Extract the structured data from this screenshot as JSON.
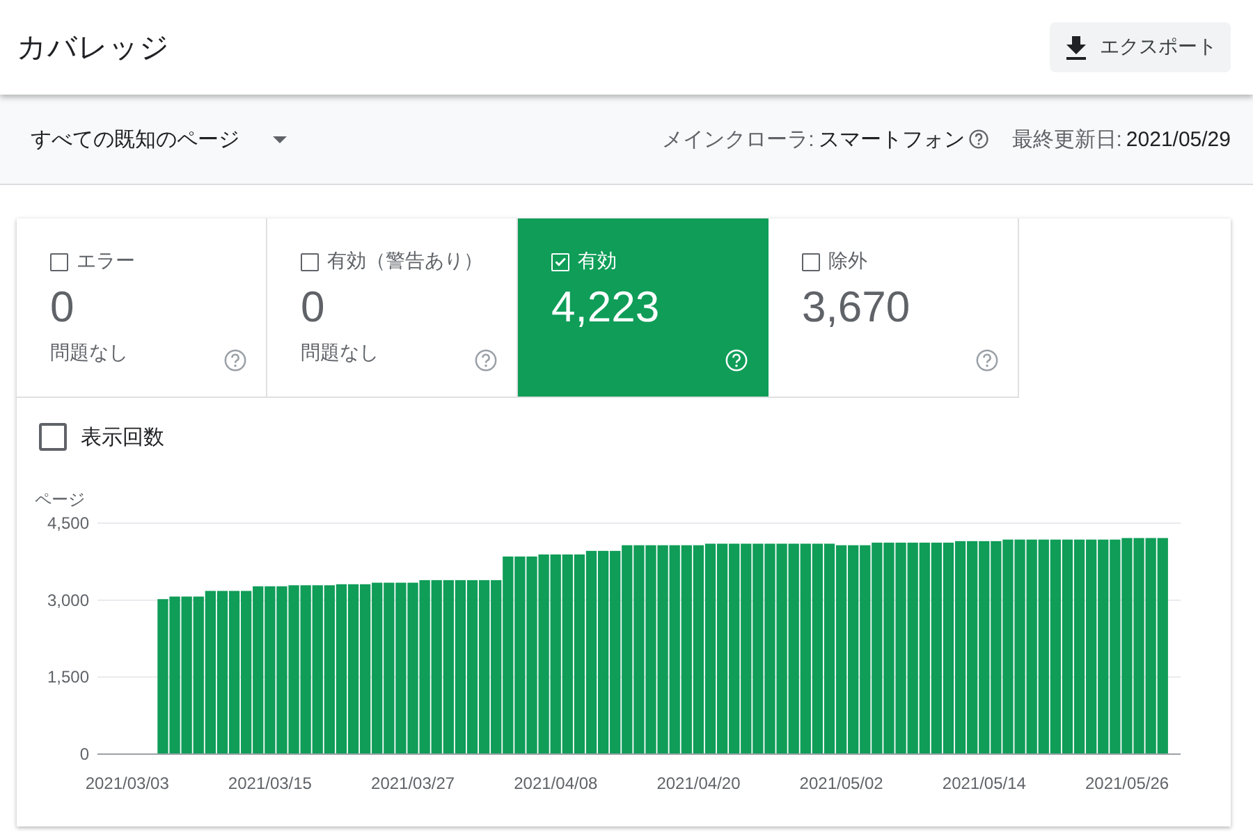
{
  "header": {
    "title": "カバレッジ",
    "export_button": "エクスポート"
  },
  "toolbar": {
    "filter": "すべての既知のページ",
    "crawler_label": "メインクローラ:",
    "crawler_value": "スマートフォン",
    "updated_label": "最終更新日:",
    "updated_value": "2021/05/29"
  },
  "tiles": [
    {
      "label": "エラー",
      "value": "0",
      "note": "問題なし",
      "selected": false
    },
    {
      "label": "有効（警告あり）",
      "value": "0",
      "note": "問題なし",
      "selected": false
    },
    {
      "label": "有効",
      "value": "4,223",
      "selected": true
    },
    {
      "label": "除外",
      "value": "3,670",
      "selected": false
    }
  ],
  "impressions": {
    "label": "表示回数",
    "checked": false
  },
  "chart": {
    "chart_data": {
      "type": "bar",
      "ylabel": "ページ",
      "categories": [
        null,
        null,
        "2021/03/03",
        null,
        null,
        null,
        null,
        null,
        null,
        null,
        null,
        null,
        null,
        null,
        "2021/03/15",
        null,
        null,
        null,
        null,
        null,
        null,
        null,
        null,
        null,
        null,
        null,
        "2021/03/27",
        null,
        null,
        null,
        null,
        null,
        null,
        null,
        null,
        null,
        null,
        null,
        "2021/04/08",
        null,
        null,
        null,
        null,
        null,
        null,
        null,
        null,
        null,
        null,
        null,
        "2021/04/20",
        null,
        null,
        null,
        null,
        null,
        null,
        null,
        null,
        null,
        null,
        null,
        "2021/05/02",
        null,
        null,
        null,
        null,
        null,
        null,
        null,
        null,
        null,
        null,
        null,
        "2021/05/14",
        null,
        null,
        null,
        null,
        null,
        null,
        null,
        null,
        null,
        null,
        null,
        "2021/05/26",
        null,
        null,
        null,
        null
      ],
      "series": [
        {
          "color": "#0f9d58",
          "values": [
            null,
            null,
            null,
            null,
            null,
            3020,
            3070,
            3070,
            3070,
            3180,
            3180,
            3180,
            3180,
            3270,
            3270,
            3270,
            3290,
            3290,
            3290,
            3290,
            3310,
            3310,
            3310,
            3340,
            3340,
            3340,
            3340,
            3390,
            3390,
            3390,
            3390,
            3390,
            3390,
            3390,
            3850,
            3850,
            3850,
            3890,
            3890,
            3890,
            3890,
            3960,
            3960,
            3960,
            4070,
            4070,
            4070,
            4070,
            4070,
            4070,
            4070,
            4100,
            4100,
            4100,
            4100,
            4100,
            4100,
            4100,
            4100,
            4100,
            4100,
            4100,
            4070,
            4070,
            4070,
            4120,
            4120,
            4120,
            4120,
            4120,
            4120,
            4120,
            4150,
            4150,
            4150,
            4150,
            4180,
            4180,
            4180,
            4180,
            4180,
            4180,
            4180,
            4180,
            4180,
            4180,
            4210,
            4210,
            4210,
            4210,
            null
          ]
        }
      ],
      "ylim": [
        0,
        4500
      ],
      "yticks": [
        {
          "value": 0,
          "label": "0"
        },
        {
          "value": 1500,
          "label": "1,500"
        },
        {
          "value": 3000,
          "label": "3,000"
        },
        {
          "value": 4500,
          "label": "4,500"
        }
      ]
    }
  }
}
